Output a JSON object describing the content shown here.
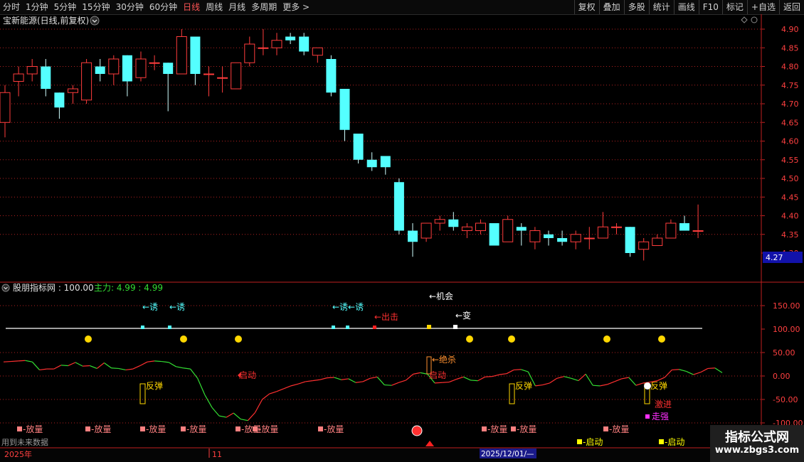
{
  "toolbar": {
    "periods": [
      "分时",
      "1分钟",
      "5分钟",
      "15分钟",
      "30分钟",
      "60分钟",
      "日线",
      "周线",
      "月线",
      "多周期",
      "更多 >"
    ],
    "active": "日线",
    "right": [
      "复权",
      "叠加",
      "多股",
      "统计",
      "画线",
      "F10",
      "标记",
      "+自选",
      "返回"
    ]
  },
  "price_panel": {
    "title": "宝新能源(日线,前复权)",
    "y_ticks": [
      "4.90",
      "4.85",
      "4.80",
      "4.75",
      "4.70",
      "4.65",
      "4.60",
      "4.55",
      "4.50",
      "4.45",
      "4.40",
      "4.35",
      "4.30"
    ],
    "current_price_box": "4.27"
  },
  "indicator_panel": {
    "title": "股朋指标网 : 100.00",
    "main_label": "主力: 4.99 : 4.99",
    "y_ticks": [
      "150.00",
      "100.00",
      "50.00",
      "0.00",
      "-50.00",
      "-100.00"
    ],
    "annotations": {
      "you": "←诱",
      "youyou": "←诱←诱",
      "chuji": "←出击",
      "bian": "←变",
      "jisha": "←绝杀",
      "qidong": "启动",
      "fantan": "反弹",
      "jijin": "激进",
      "zouqiang": "走强",
      "top_clip": "←机会",
      "fangliang": "放量",
      "bottom_qidong": "启动"
    }
  },
  "status": {
    "left_text": "用到未来数据",
    "year": "2025年",
    "month": "11",
    "date_box": "2025/12/01/—",
    "watermark_title": "指标公式网",
    "watermark_url": "www.zbgs3.com"
  },
  "colors": {
    "up": "#ff3c3c",
    "down": "#54ffff",
    "grid": "#b02020",
    "accent": "#ff3333"
  },
  "chart_data": {
    "type": "candlestick",
    "y_range": [
      4.3,
      4.9
    ],
    "candles": [
      {
        "o": 4.65,
        "h": 4.75,
        "l": 4.61,
        "c": 4.73
      },
      {
        "o": 4.76,
        "h": 4.8,
        "l": 4.72,
        "c": 4.78
      },
      {
        "o": 4.78,
        "h": 4.82,
        "l": 4.76,
        "c": 4.8
      },
      {
        "o": 4.8,
        "h": 4.82,
        "l": 4.72,
        "c": 4.74
      },
      {
        "o": 4.73,
        "h": 4.73,
        "l": 4.66,
        "c": 4.69
      },
      {
        "o": 4.73,
        "h": 4.75,
        "l": 4.7,
        "c": 4.74
      },
      {
        "o": 4.71,
        "h": 4.82,
        "l": 4.7,
        "c": 4.81
      },
      {
        "o": 4.8,
        "h": 4.82,
        "l": 4.76,
        "c": 4.78
      },
      {
        "o": 4.78,
        "h": 4.83,
        "l": 4.75,
        "c": 4.82
      },
      {
        "o": 4.83,
        "h": 4.83,
        "l": 4.72,
        "c": 4.76
      },
      {
        "o": 4.77,
        "h": 4.84,
        "l": 4.76,
        "c": 4.82
      },
      {
        "o": 4.81,
        "h": 4.83,
        "l": 4.79,
        "c": 4.81
      },
      {
        "o": 4.81,
        "h": 4.81,
        "l": 4.68,
        "c": 4.78
      },
      {
        "o": 4.78,
        "h": 4.9,
        "l": 4.78,
        "c": 4.88
      },
      {
        "o": 4.88,
        "h": 4.88,
        "l": 4.75,
        "c": 4.78
      },
      {
        "o": 4.78,
        "h": 4.8,
        "l": 4.72,
        "c": 4.78
      },
      {
        "o": 4.77,
        "h": 4.8,
        "l": 4.73,
        "c": 4.77
      },
      {
        "o": 4.74,
        "h": 4.81,
        "l": 4.74,
        "c": 4.81
      },
      {
        "o": 4.81,
        "h": 4.88,
        "l": 4.8,
        "c": 4.86
      },
      {
        "o": 4.85,
        "h": 4.9,
        "l": 4.83,
        "c": 4.85
      },
      {
        "o": 4.85,
        "h": 4.89,
        "l": 4.83,
        "c": 4.87
      },
      {
        "o": 4.88,
        "h": 4.89,
        "l": 4.86,
        "c": 4.87
      },
      {
        "o": 4.88,
        "h": 4.89,
        "l": 4.83,
        "c": 4.84
      },
      {
        "o": 4.83,
        "h": 4.85,
        "l": 4.81,
        "c": 4.85
      },
      {
        "o": 4.82,
        "h": 4.83,
        "l": 4.72,
        "c": 4.73
      },
      {
        "o": 4.74,
        "h": 4.74,
        "l": 4.6,
        "c": 4.63
      },
      {
        "o": 4.62,
        "h": 4.62,
        "l": 4.54,
        "c": 4.55
      },
      {
        "o": 4.55,
        "h": 4.57,
        "l": 4.52,
        "c": 4.53
      },
      {
        "o": 4.56,
        "h": 4.56,
        "l": 4.51,
        "c": 4.53
      },
      {
        "o": 4.49,
        "h": 4.5,
        "l": 4.35,
        "c": 4.36
      },
      {
        "o": 4.36,
        "h": 4.38,
        "l": 4.29,
        "c": 4.33
      },
      {
        "o": 4.34,
        "h": 4.38,
        "l": 4.33,
        "c": 4.38
      },
      {
        "o": 4.38,
        "h": 4.4,
        "l": 4.36,
        "c": 4.39
      },
      {
        "o": 4.39,
        "h": 4.41,
        "l": 4.36,
        "c": 4.37
      },
      {
        "o": 4.36,
        "h": 4.38,
        "l": 4.34,
        "c": 4.37
      },
      {
        "o": 4.36,
        "h": 4.39,
        "l": 4.35,
        "c": 4.38
      },
      {
        "o": 4.38,
        "h": 4.38,
        "l": 4.32,
        "c": 4.32
      },
      {
        "o": 4.33,
        "h": 4.4,
        "l": 4.33,
        "c": 4.39
      },
      {
        "o": 4.37,
        "h": 4.38,
        "l": 4.32,
        "c": 4.36
      },
      {
        "o": 4.33,
        "h": 4.37,
        "l": 4.31,
        "c": 4.36
      },
      {
        "o": 4.35,
        "h": 4.36,
        "l": 4.32,
        "c": 4.34
      },
      {
        "o": 4.34,
        "h": 4.36,
        "l": 4.32,
        "c": 4.33
      },
      {
        "o": 4.33,
        "h": 4.36,
        "l": 4.31,
        "c": 4.35
      },
      {
        "o": 4.34,
        "h": 4.37,
        "l": 4.31,
        "c": 4.34
      },
      {
        "o": 4.34,
        "h": 4.41,
        "l": 4.34,
        "c": 4.37
      },
      {
        "o": 4.37,
        "h": 4.38,
        "l": 4.35,
        "c": 4.37
      },
      {
        "o": 4.37,
        "h": 4.37,
        "l": 4.29,
        "c": 4.3
      },
      {
        "o": 4.31,
        "h": 4.34,
        "l": 4.28,
        "c": 4.33
      },
      {
        "o": 4.32,
        "h": 4.35,
        "l": 4.32,
        "c": 4.34
      },
      {
        "o": 4.34,
        "h": 4.39,
        "l": 4.34,
        "c": 4.38
      },
      {
        "o": 4.38,
        "h": 4.4,
        "l": 4.36,
        "c": 4.36
      },
      {
        "o": 4.36,
        "h": 4.43,
        "l": 4.34,
        "c": 4.36
      }
    ],
    "indicator_line": [
      30,
      31,
      32,
      33,
      30,
      13,
      15,
      15,
      23,
      22,
      29,
      21,
      22,
      16,
      28,
      17,
      16,
      13,
      15,
      22,
      30,
      32,
      31,
      29,
      20,
      17,
      15,
      -5,
      -40,
      -67,
      -85,
      -88,
      -79,
      -92,
      -95,
      -78,
      -50,
      -38,
      -33,
      -27,
      -21,
      -17,
      -12,
      -10,
      -8,
      -4,
      -3,
      -8,
      -6,
      -14,
      -12,
      -5,
      -2,
      -19,
      -20,
      -14,
      -9,
      4,
      7,
      4,
      -15,
      -14,
      -13,
      -7,
      -2,
      -9,
      -10,
      -2,
      -1,
      3,
      5,
      13,
      14,
      9,
      -21,
      -19,
      -15,
      -5,
      -1,
      -5,
      -10,
      4,
      -20,
      -21,
      -18,
      -12,
      -6,
      -3,
      -20,
      -15,
      -13,
      -10,
      -3,
      13,
      14,
      10,
      3,
      8,
      16,
      17,
      7
    ]
  }
}
